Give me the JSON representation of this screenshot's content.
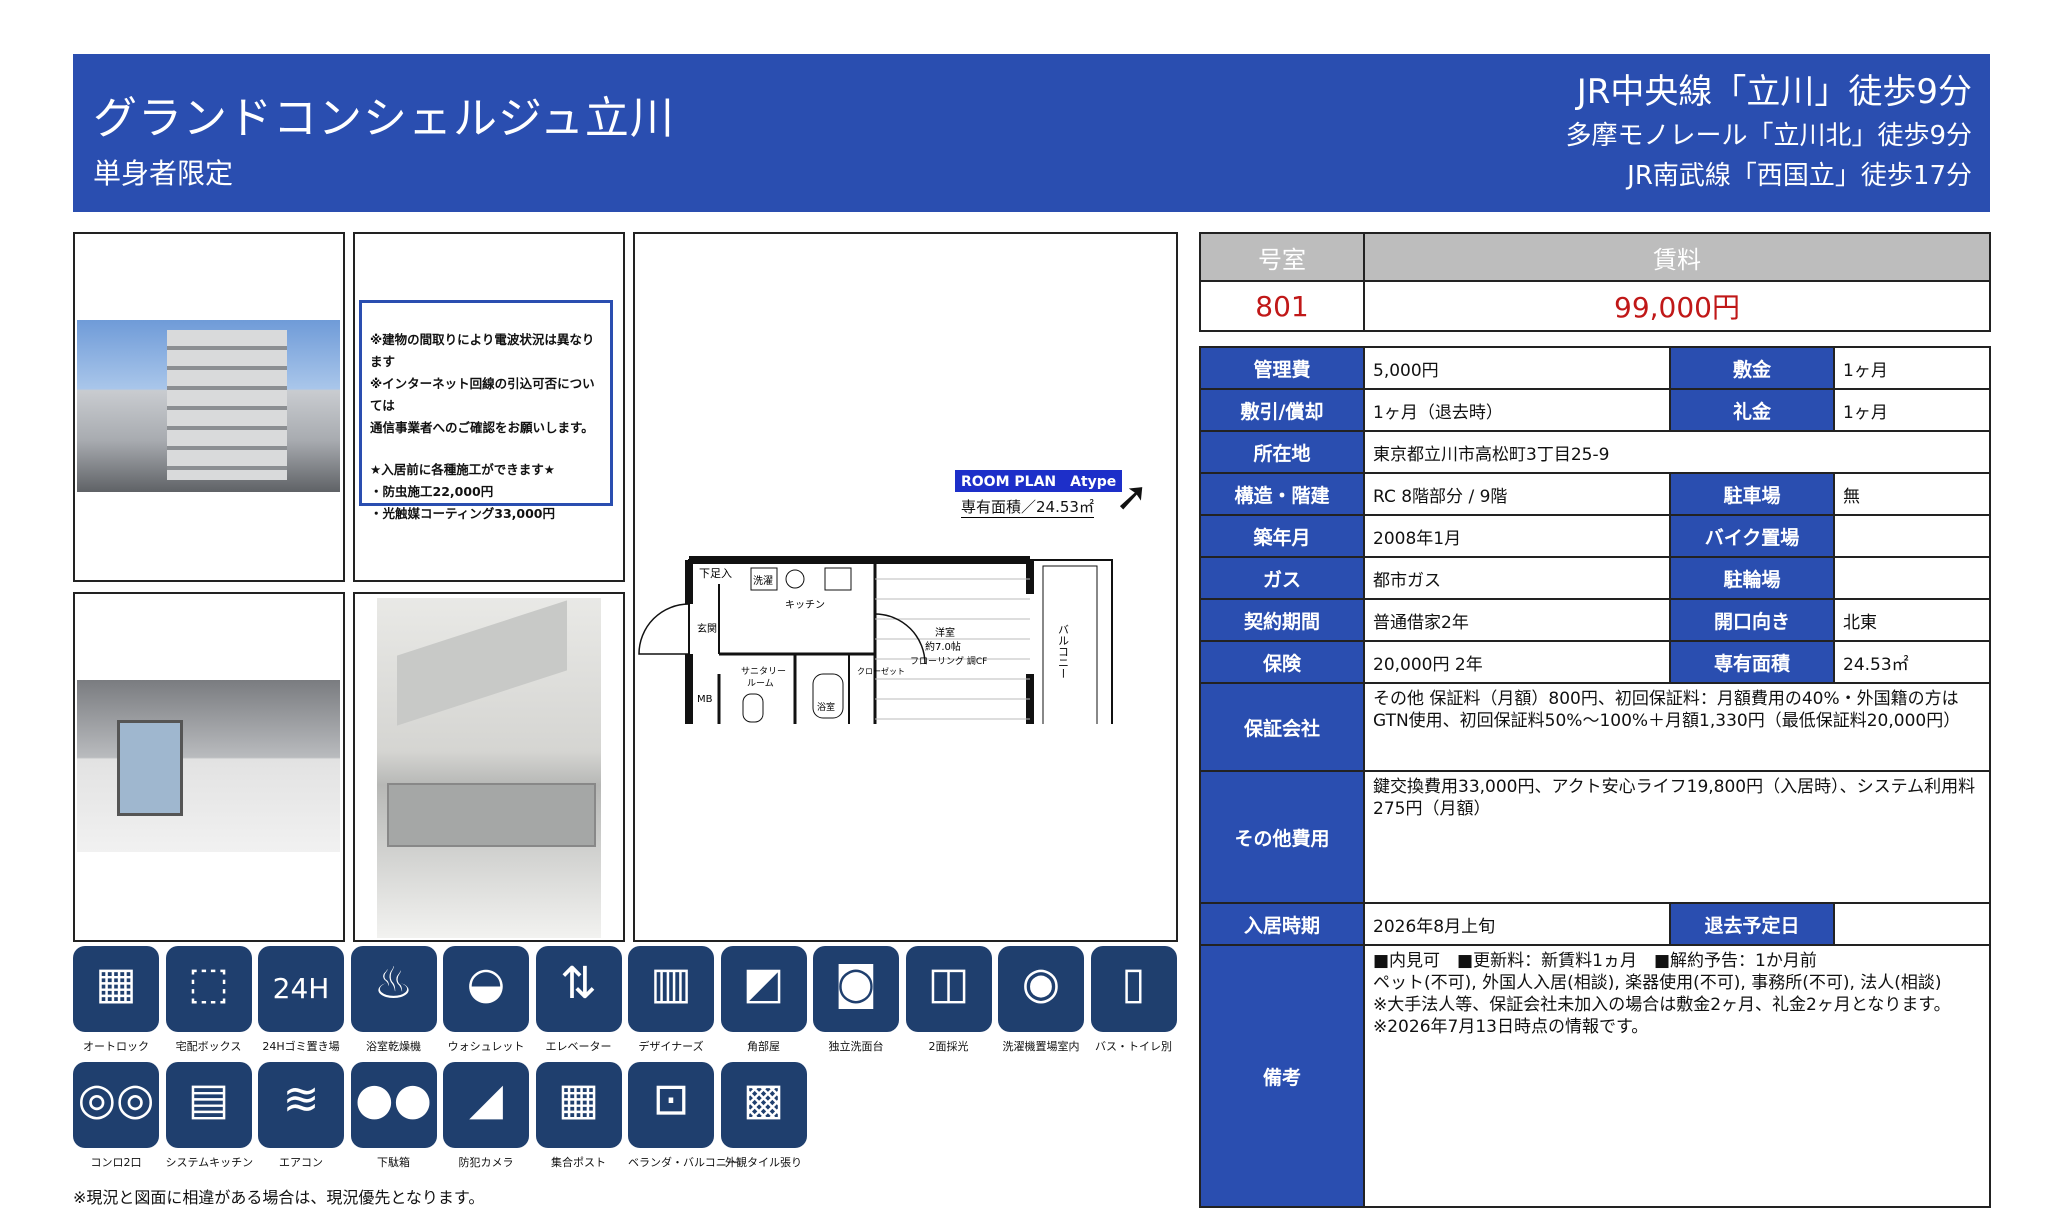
{
  "header": {
    "title": "グランドコンシェルジュ立川",
    "subtitle": "単身者限定",
    "access": [
      "JR中央線「立川」徒歩9分",
      "多摩モノレール「立川北」徒歩9分",
      "JR南武線「西国立」徒歩17分"
    ]
  },
  "notice": {
    "lines": [
      "※建物の間取りにより電波状況は異なります",
      "※インターネット回線の引込可否については",
      "通信事業者へのご確認をお願いします。"
    ],
    "lines2": [
      "★入居前に各種施工ができます★",
      "・防虫施工22,000円",
      "・光触媒コーティング33,000円"
    ]
  },
  "floorplan": {
    "label": "ROOM PLAN　Atype",
    "area": "専有面積／24.53㎡",
    "rooms": {
      "shoes": "下足入",
      "washer": "洗濯",
      "kitchen": "キッチン",
      "entrance": "玄関",
      "living": "洋室",
      "living_size": "約7.0帖",
      "floor": "フローリング 調CF",
      "sanitary": "サニタリー",
      "room": "ルーム",
      "bath": "浴室",
      "mb": "MB",
      "closet": "クローゼット",
      "balcony": "バルコニー"
    }
  },
  "rent_table": {
    "room_label": "号室",
    "rent_label": "賃料",
    "room": "801",
    "rent": "99,000円"
  },
  "info": {
    "kanri_l": "管理費",
    "kanri": "5,000円",
    "shiki_l": "敷金",
    "shiki": "1ヶ月",
    "shikibiki_l": "敷引/償却",
    "shikibiki": "1ヶ月（退去時）",
    "rei_l": "礼金",
    "rei": "1ヶ月",
    "addr_l": "所在地",
    "addr": "東京都立川市高松町3丁目25-9",
    "kozo_l": "構造・階建",
    "kozo": "RC 8階部分 / 9階",
    "parking_l": "駐車場",
    "parking": "無",
    "chiku_l": "築年月",
    "chiku": "2008年1月",
    "bike_l": "バイク置場",
    "bike": "",
    "gas_l": "ガス",
    "gas": "都市ガス",
    "cycle_l": "駐輪場",
    "cycle": "",
    "keiyaku_l": "契約期間",
    "keiyaku": "普通借家2年",
    "muki_l": "開口向き",
    "muki": "北東",
    "hoken_l": "保険",
    "hoken": "20,000円 2年",
    "menseki_l": "専有面積",
    "menseki": "24.53㎡",
    "hosho_l": "保証会社",
    "hosho": "その他 保証料（月額）800円、初回保証料：月額費用の40%・外国籍の方はGTN使用、初回保証料50%〜100%＋月額1,330円（最低保証料20,000円）",
    "sonota_l": "その他費用",
    "sonota": "鍵交換費用33,000円、アクト安心ライフ19,800円（入居時）、システム利用料275円（月額）",
    "nyukyo_l": "入居時期",
    "nyukyo": "2026年8月上旬",
    "taikyo_l": "退去予定日",
    "taikyo": "",
    "biko_l": "備考",
    "biko": [
      "■内見可　■更新料：新賃料1ヵ月　■解約予告：1か月前",
      "ペット(不可), 外国人入居(相談), 楽器使用(不可), 事務所(不可), 法人(相談)",
      "※大手法人等、保証会社未加入の場合は敷金2ヶ月、礼金2ヶ月となります。",
      "※2026年7月13日時点の情報です。"
    ]
  },
  "icons": [
    {
      "label": "オートロック",
      "name": "autolock-icon",
      "glyph": "▦"
    },
    {
      "label": "宅配ボックス",
      "name": "delivery-box-icon",
      "glyph": "⬚"
    },
    {
      "label": "24Hゴミ置き場",
      "name": "garbage-24h-icon",
      "glyph": "24H"
    },
    {
      "label": "浴室乾燥機",
      "name": "bathroom-dryer-icon",
      "glyph": "♨"
    },
    {
      "label": "ウォシュレット",
      "name": "washlet-icon",
      "glyph": "◒"
    },
    {
      "label": "エレベーター",
      "name": "elevator-icon",
      "glyph": "⇅"
    },
    {
      "label": "デザイナーズ",
      "name": "designers-icon",
      "glyph": "▥"
    },
    {
      "label": "角部屋",
      "name": "corner-room-icon",
      "glyph": "◩"
    },
    {
      "label": "独立洗面台",
      "name": "washbasin-icon",
      "glyph": "◙"
    },
    {
      "label": "2面採光",
      "name": "two-side-light-icon",
      "glyph": "◫"
    },
    {
      "label": "洗濯機置場室内",
      "name": "washing-machine-icon",
      "glyph": "◉"
    },
    {
      "label": "バス・トイレ別",
      "name": "bath-toilet-separate-icon",
      "glyph": "▯"
    },
    {
      "label": "コンロ2口",
      "name": "stove-2-icon",
      "glyph": "◎◎"
    },
    {
      "label": "システムキッチン",
      "name": "system-kitchen-icon",
      "glyph": "▤"
    },
    {
      "label": "エアコン",
      "name": "air-conditioner-icon",
      "glyph": "≋"
    },
    {
      "label": "下駄箱",
      "name": "shoe-box-icon",
      "glyph": "●●"
    },
    {
      "label": "防犯カメラ",
      "name": "security-camera-icon",
      "glyph": "◢"
    },
    {
      "label": "集合ポスト",
      "name": "mailbox-icon",
      "glyph": "▦"
    },
    {
      "label": "ベランダ・バルコニー",
      "name": "balcony-icon",
      "glyph": "⊡"
    },
    {
      "label": "外観タイル張り",
      "name": "tile-exterior-icon",
      "glyph": "▩"
    }
  ],
  "footnote": "※現況と図面に相違がある場合は、現況優先となります。"
}
